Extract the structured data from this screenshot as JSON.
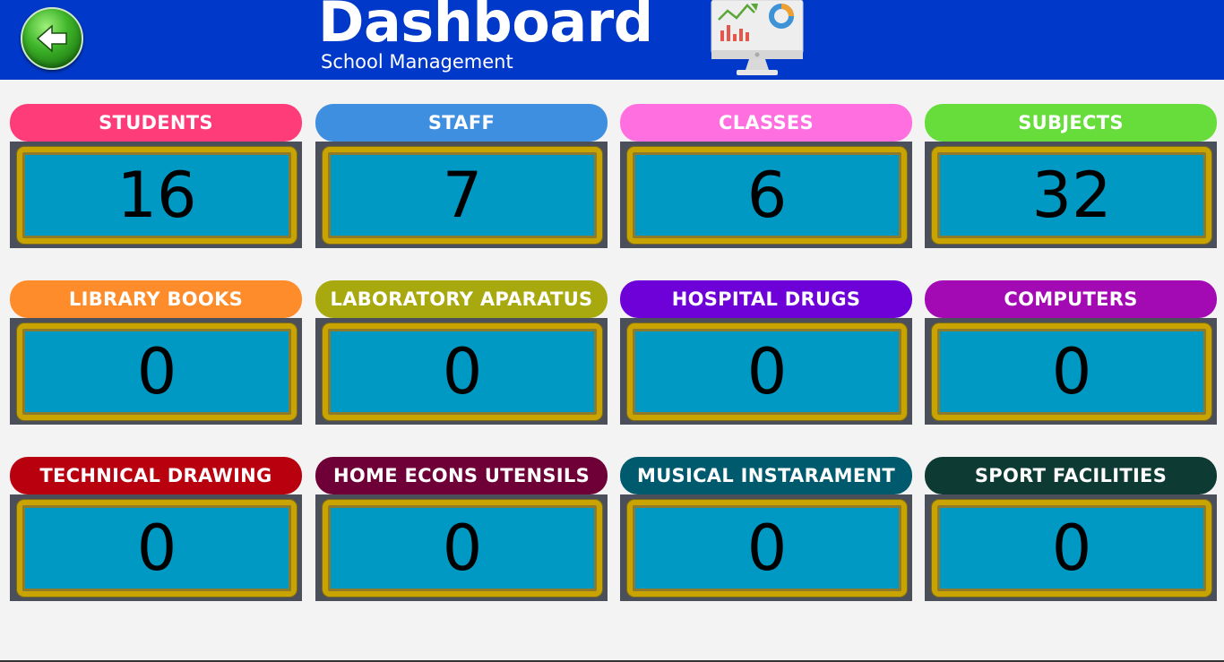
{
  "header": {
    "title": "Dashboard",
    "subtitle": "School Management",
    "back_icon": "back-arrow-icon",
    "monitor_icon": "monitor-chart-icon"
  },
  "cards": [
    {
      "label": "STUDENTS",
      "value": "16",
      "color": "#ff3c7a"
    },
    {
      "label": "STAFF",
      "value": "7",
      "color": "#3f8fe0"
    },
    {
      "label": "CLASSES",
      "value": "6",
      "color": "#ff6fe0"
    },
    {
      "label": "SUBJECTS",
      "value": "32",
      "color": "#66dd3a"
    },
    {
      "label": "LIBRARY BOOKS",
      "value": "0",
      "color": "#ff8c2a"
    },
    {
      "label": "LABORATORY APARATUS",
      "value": "0",
      "color": "#a8a80f"
    },
    {
      "label": "HOSPITAL DRUGS",
      "value": "0",
      "color": "#6e00d8"
    },
    {
      "label": "COMPUTERS",
      "value": "0",
      "color": "#a30ab4"
    },
    {
      "label": "TECHNICAL DRAWING",
      "value": "0",
      "color": "#b8000e"
    },
    {
      "label": "HOME ECONS UTENSILS",
      "value": "0",
      "color": "#6e0037"
    },
    {
      "label": "MUSICAL INSTARAMENT",
      "value": "0",
      "color": "#005a6e"
    },
    {
      "label": "SPORT FACILITIES",
      "value": "0",
      "color": "#0e3a34"
    }
  ],
  "colors": {
    "header_bg": "#0038c9",
    "value_bg": "#0099c4",
    "value_border": "#c9a300",
    "frame": "#4a4f5a",
    "page_bg": "#f3f3f3"
  }
}
